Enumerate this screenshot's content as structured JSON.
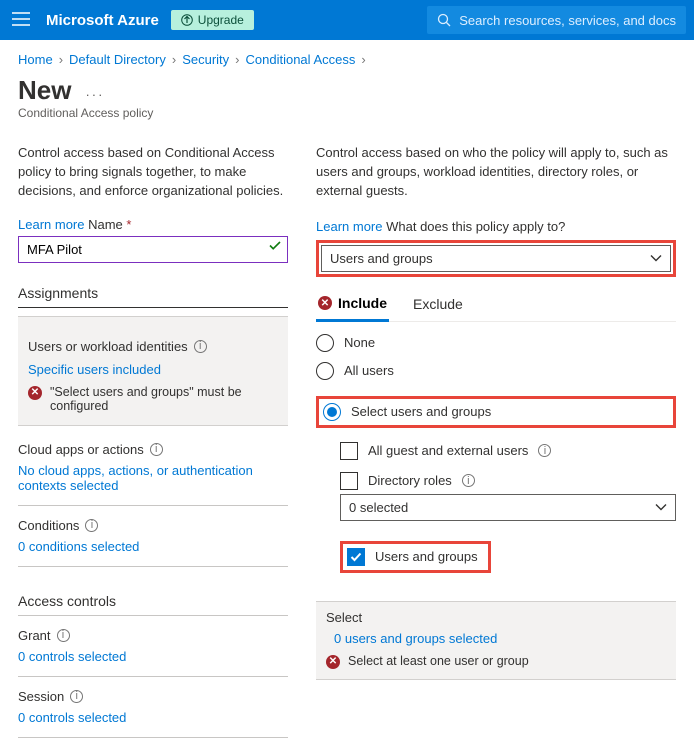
{
  "topbar": {
    "brand": "Microsoft Azure",
    "upgrade": "Upgrade",
    "search_placeholder": "Search resources, services, and docs"
  },
  "breadcrumb": [
    "Home",
    "Default Directory",
    "Security",
    "Conditional Access"
  ],
  "title": "New",
  "subtitle": "Conditional Access policy",
  "left": {
    "intro": "Control access based on Conditional Access policy to bring signals together, to make decisions, and enforce organizational policies.",
    "learn": "Learn more",
    "name_label": "Name",
    "name_value": "MFA Pilot",
    "assignments_head": "Assignments",
    "uwi_label": "Users or workload identities",
    "uwi_link": "Specific users included",
    "uwi_error": "\"Select users and groups\" must be configured",
    "cloud_label": "Cloud apps or actions",
    "cloud_link": "No cloud apps, actions, or authentication contexts selected",
    "cond_label": "Conditions",
    "cond_link": "0 conditions selected",
    "access_head": "Access controls",
    "grant_label": "Grant",
    "grant_link": "0 controls selected",
    "session_label": "Session",
    "session_link": "0 controls selected"
  },
  "right": {
    "intro": "Control access based on who the policy will apply to, such as users and groups, workload identities, directory roles, or external guests.",
    "learn": "Learn more",
    "apply_label": "What does this policy apply to?",
    "apply_value": "Users and groups",
    "tab_include": "Include",
    "tab_exclude": "Exclude",
    "r_none": "None",
    "r_all": "All users",
    "r_select": "Select users and groups",
    "cb_guest": "All guest and external users",
    "cb_roles": "Directory roles",
    "roles_dd": "0 selected",
    "cb_usersgroups": "Users and groups",
    "select_head": "Select",
    "select_link": "0 users and groups selected",
    "select_error": "Select at least one user or group"
  }
}
